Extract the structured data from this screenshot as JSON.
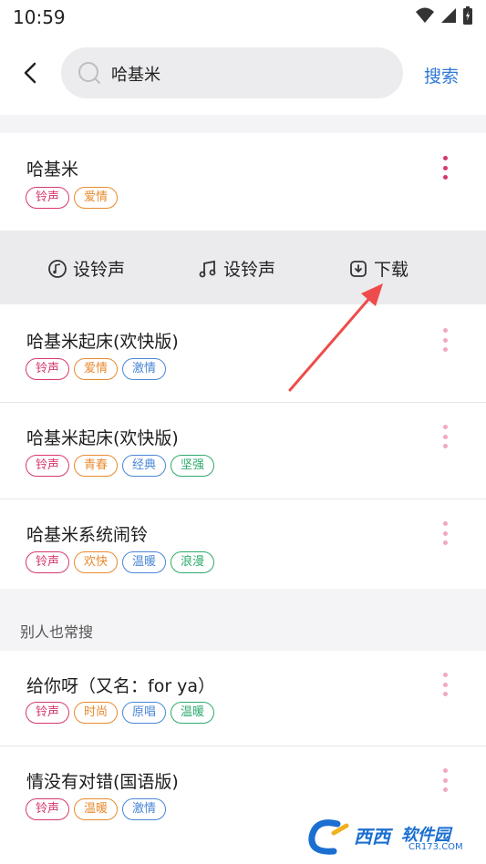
{
  "status": {
    "time": "10:59"
  },
  "search": {
    "query": "哈基米",
    "action_label": "搜索"
  },
  "top_result": {
    "title": "哈基米",
    "tags": [
      {
        "label": "铃声",
        "color": "#d8386b"
      },
      {
        "label": "爱情",
        "color": "#e88a2e"
      }
    ]
  },
  "actions": [
    {
      "label": "设铃声",
      "icon": "ringtone-icon"
    },
    {
      "label": "设铃声",
      "icon": "music-note-icon"
    },
    {
      "label": "下载",
      "icon": "download-icon"
    }
  ],
  "results": [
    {
      "title": "哈基米起床(欢快版)",
      "tags": [
        {
          "label": "铃声",
          "color": "#d8386b"
        },
        {
          "label": "爱情",
          "color": "#e88a2e"
        },
        {
          "label": "激情",
          "color": "#4a86d6"
        }
      ]
    },
    {
      "title": "哈基米起床(欢快版)",
      "tags": [
        {
          "label": "铃声",
          "color": "#d8386b"
        },
        {
          "label": "青春",
          "color": "#e88a2e"
        },
        {
          "label": "经典",
          "color": "#4a86d6"
        },
        {
          "label": "坚强",
          "color": "#2eaa6e"
        }
      ]
    },
    {
      "title": "哈基米系统闹铃",
      "tags": [
        {
          "label": "铃声",
          "color": "#d8386b"
        },
        {
          "label": "欢快",
          "color": "#e88a2e"
        },
        {
          "label": "温暖",
          "color": "#4a86d6"
        },
        {
          "label": "浪漫",
          "color": "#2eaa6e"
        }
      ]
    }
  ],
  "also_searched": {
    "title": "别人也常搜",
    "items": [
      {
        "title": "给你呀（又名：for ya）",
        "tags": [
          {
            "label": "铃声",
            "color": "#d8386b"
          },
          {
            "label": "时尚",
            "color": "#e88a2e"
          },
          {
            "label": "原唱",
            "color": "#4a86d6"
          },
          {
            "label": "温暖",
            "color": "#2eaa6e"
          }
        ]
      },
      {
        "title": "情没有对错(国语版)",
        "tags": [
          {
            "label": "铃声",
            "color": "#d8386b"
          },
          {
            "label": "温暖",
            "color": "#e88a2e"
          },
          {
            "label": "激情",
            "color": "#4a86d6"
          }
        ]
      }
    ]
  },
  "watermark": {
    "brand": "西西",
    "label": "软件园",
    "domain": "CR173.COM"
  },
  "colors": {
    "accent": "#2f78d6",
    "more_active": "#d8386b",
    "more_inactive": "#f0a9bf",
    "arrow": "#ee4c4c"
  }
}
